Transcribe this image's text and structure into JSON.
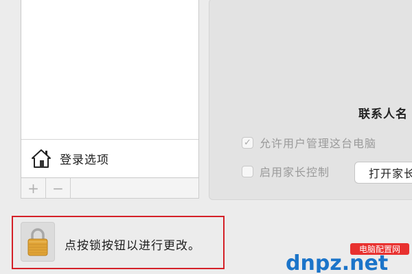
{
  "user_list": {
    "login_options_label": "登录选项",
    "add_symbol": "+",
    "remove_symbol": "−"
  },
  "settings": {
    "contact_card_label": "联系人名",
    "allow_admin_label": "允许用户管理这台电脑",
    "allow_admin_checked": true,
    "parental_controls_label": "启用家长控制",
    "parental_controls_checked": false,
    "open_parental_button_label": "打开家长控制"
  },
  "lock": {
    "message": "点按锁按钮以进行更改。"
  },
  "watermark": {
    "brand_text": "dnpz.net",
    "badge_text": "电脑配置网"
  },
  "colors": {
    "highlight_border": "#d42027",
    "watermark_blue": "#1b74c9",
    "watermark_badge": "#e8312f",
    "lock_gold": "#e0a437"
  }
}
